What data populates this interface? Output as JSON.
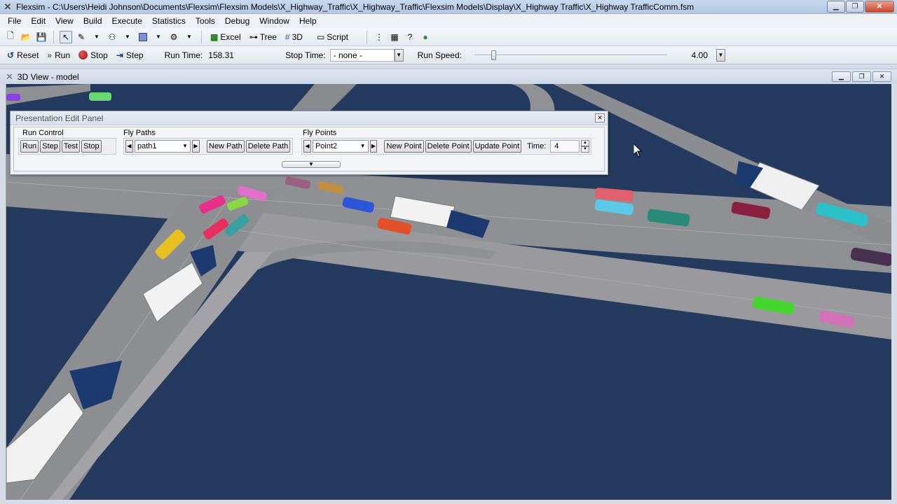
{
  "window": {
    "title": "Flexsim - C:\\Users\\Heidi Johnson\\Documents\\Flexsim\\Flexsim Models\\X_Highway_Traffic\\X_Highway_Traffic\\Flexsim Models\\Display\\X_Highway Traffic\\X_Highway TrafficComm.fsm",
    "app_icon": "flexsim-logo-icon"
  },
  "menu": [
    "File",
    "Edit",
    "View",
    "Build",
    "Execute",
    "Statistics",
    "Tools",
    "Debug",
    "Window",
    "Help"
  ],
  "toolbar": {
    "excel_label": "Excel",
    "tree_label": "Tree",
    "view3d_label": "3D",
    "script_label": "Script"
  },
  "runbar": {
    "reset_label": "Reset",
    "run_label": "Run",
    "stop_label": "Stop",
    "step_label": "Step",
    "run_time_label": "Run Time:",
    "run_time_value": "158.31",
    "stop_time_label": "Stop Time:",
    "stop_time_value": "- none -",
    "run_speed_label": "Run Speed:",
    "run_speed_value": "4.00",
    "run_speed_fraction": 0.09
  },
  "view": {
    "title": "3D View - model"
  },
  "panel": {
    "title": "Presentation Edit Panel",
    "run_control": {
      "label": "Run Control",
      "buttons": [
        "Run",
        "Step",
        "Test",
        "Stop"
      ]
    },
    "fly_paths": {
      "label": "Fly Paths",
      "selected": "path1",
      "new_label": "New Path",
      "delete_label": "Delete Path"
    },
    "fly_points": {
      "label": "Fly Points",
      "selected": "Point2",
      "new_label": "New Point",
      "delete_label": "Delete Point",
      "update_label": "Update Point",
      "time_label": "Time:",
      "time_value": "4"
    }
  },
  "colors": {
    "water": "#243a5e",
    "road": "#8e8e92",
    "road_light": "#a4a4a8"
  }
}
